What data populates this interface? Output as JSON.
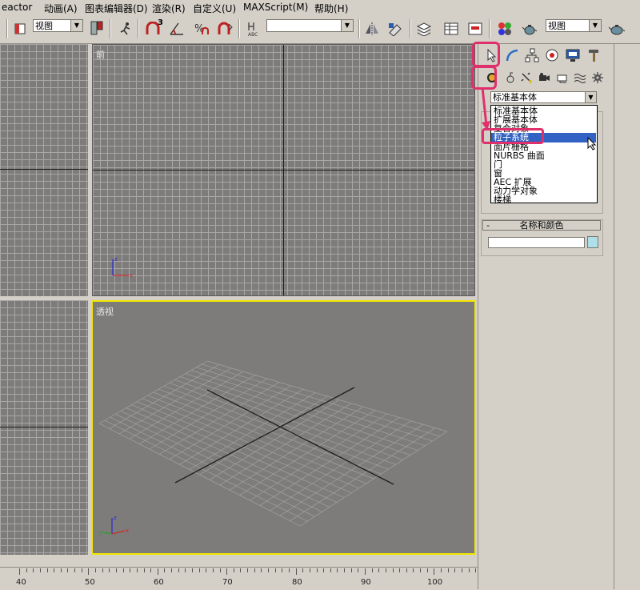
{
  "menu": [
    "eactor",
    "动画(A)",
    "图表编辑器(D)",
    "渲染(R)",
    "自定义(U)",
    "MAXScript(M)",
    "帮助(H)"
  ],
  "toolbar": {
    "view_combo": "视图",
    "view_combo_right": "视图",
    "snap_number": "3",
    "selection_set_combo": ""
  },
  "viewports": {
    "front_label": "前",
    "perspective_label": "透视",
    "active_border_color": "#f2e600"
  },
  "command_panel": {
    "category_selected": "标准基本体",
    "dropdown_items": [
      "标准基本体",
      "扩展基本体",
      "复合对象",
      "粒子系统",
      "面片栅格",
      "NURBS 曲面",
      "门",
      "窗",
      "AEC 扩展",
      "动力学对象",
      "楼梯"
    ],
    "dropdown_selected_index": 3,
    "name_color_rollout": "名称和颜色",
    "object_color": "#aee0ec",
    "highlight_color": "#e0306c"
  },
  "ruler": {
    "labels": [
      "40",
      "50",
      "60",
      "70",
      "80",
      "90",
      "100"
    ]
  }
}
